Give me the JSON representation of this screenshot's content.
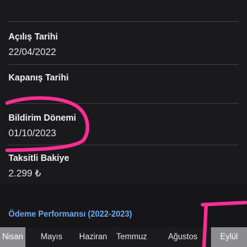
{
  "details": {
    "fields": [
      {
        "label": "Açılış Tarihi",
        "value": "22/04/2022"
      },
      {
        "label": "Kapanış Tarihi",
        "value": ""
      },
      {
        "label": "Bildirim Dönemi",
        "value": "01/10/2023"
      },
      {
        "label": "Taksitli Bakiye",
        "value": "2.299 ₺"
      }
    ]
  },
  "performance": {
    "title": "Ödeme Performansı (2022-2023)",
    "months": [
      "Nisan",
      "Mayıs",
      "Haziran",
      "Temmuz",
      "Ağustos",
      "Eylül"
    ],
    "selected_month": "Eylül"
  },
  "annotation": {
    "color": "#ff2d95"
  }
}
